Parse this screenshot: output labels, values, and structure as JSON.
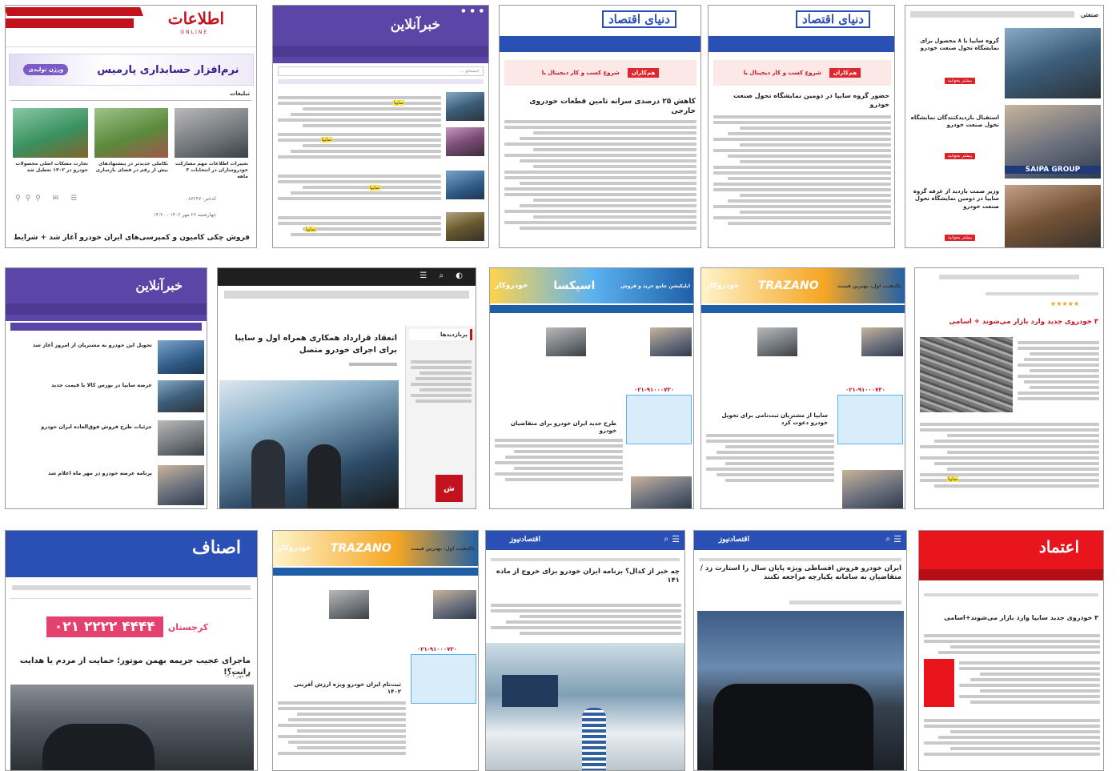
{
  "screens": {
    "s1": {
      "logo": "اطلاعات",
      "logo_sub": "ONLINE",
      "ad_text": "نرم‌افزار حسابداری پارمیس",
      "ad_badge": "ورژن تولیدی",
      "section": "تبلیغات",
      "cards": [
        "تغییرات اطلاعات مهم مشارکت خودروسازان در انتخابات ۳ ماهه",
        "تکاملی جدیدتر در پیشنهادهای بیش از رقم در فضای بازسازی",
        "تجارت مشکات اصلی محصولات خودرو در ۱۴۰۲ تعطیل شد"
      ],
      "meta1": "کدخبر: ۸۶۲۴۷",
      "meta2": "چهارشنبه ۲۶ مهر ۱۴۰۲ - ۱۴:۲۰",
      "headline": "فروش چکی کامیون و کمپرسی‌های ایران خودرو آغاز شد + شرایط"
    },
    "s2": {
      "logo": "خبرآنلاین",
      "search_placeholder": "جستجو ...",
      "highlight": "سایپا"
    },
    "s3": {
      "logo": "دنیای اقتصاد",
      "ad_text": "شروع کسب و کار دیجیتال با",
      "ad_brand": "هم‌کاران",
      "headline": "کاهش ۲۵ درصدی سرانه تامین قطعات خودروی خارجی"
    },
    "s4": {
      "logo": "دنیای اقتصاد",
      "ad_text": "شروع کسب و کار دیجیتال با",
      "ad_brand": "هم‌کاران",
      "headline": "حضور گروه سایپا در دومین نمایشگاه تحول صنعت خودرو"
    },
    "s5": {
      "logo": "صنعتی",
      "items": [
        "گروه سایپا با ۸ محصول برای نمایشگاه تحول صنعت خودرو",
        "استقبال بازدیدکنندگان نمایشگاه تحول صنعت خودرو",
        "وزیر صمت بازدید از غرفه گروه سایپا در دومین نمایشگاه تحول صنعت خودرو"
      ],
      "button": "بیشتر بخوانید",
      "photo_caption": "SAIPA GROUP"
    },
    "s6": {
      "logo": "خبرآنلاین",
      "items": [
        "تحویل این خودرو به مشتریان از امروز آغاز شد",
        "عرضه سایپا در بورس کالا با قیمت جدید",
        "جزئیات طرح فروش فوق‌العاده ایران خودرو",
        "برنامه عرضه خودرو در مهر ماه اعلام شد"
      ]
    },
    "s7": {
      "headline": "انعقاد قرارداد همکاری همراه اول و سایپا برای اجرای خودرو متصل",
      "highlight": "سایپا",
      "tab": "پربازدیدها"
    },
    "s8": {
      "ad_text": "اسپکسا",
      "ad_sub": "اپلیکیشن جامع خرید و فروش",
      "logo": "خودروکار",
      "phone": "۰۲۱-۹۱۰۰۰۷۳۰",
      "headline": "طرح جدید ایران خودرو برای متقاضیان خودرو"
    },
    "s9": {
      "ad_text": "TRAZANO",
      "ad_sub": "باکیفیت اول، بهترین قیمت",
      "logo": "خودروکار",
      "phone": "۰۲۱-۹۱۰۰۰۷۳۰",
      "headline": "سایپا از مشتریان ثبت‌نامی برای تحویل خودرو دعوت کرد"
    },
    "s10": {
      "stars": "★★★★★",
      "headline": "۳ خودروی جدید وارد بازار می‌شوند + اسامی",
      "highlight": "سایپا"
    },
    "s11": {
      "logo": "اصناف",
      "ad_text": "۰۲۱ ۲۲۲۲ ۴۴۴۴",
      "ad_brand": "کرجستان",
      "headline": "ماجرای عجیب جریمه بهمن موتور؛ حمایت از مردم یا هدایت رانت؟!",
      "date": "۲۶ مهر ۱۴۰۲"
    },
    "s12": {
      "ad_text": "TRAZANO",
      "ad_sub": "باکیفیت اول، بهترین قیمت",
      "logo": "خودروکار",
      "phone": "۰۲۱-۹۱۰۰۰۷۳۰",
      "headline": "ثبت‌نام ایران خودرو ویژه ارزش آفرینی ۱۴۰۲"
    },
    "s13": {
      "logo": "اقتصادنیوز",
      "headline": "چه خبر از کدال؟ برنامه ایران خودرو برای خروج از ماده ۱۴۱"
    },
    "s14": {
      "logo": "اقتصادنیوز",
      "headline": "ایران خودرو فروش اقساطی ویژه پایان سال را استارت زد / متقاضیان به سامانه یکپارچه مراجعه نکنند"
    },
    "s15": {
      "logo": "اعتماد",
      "headline": "۳ خودروی جدید سایپا وارد بازار می‌شوند+اسامی"
    }
  },
  "colors": {
    "purple": "#5b45a6",
    "blue": "#2a4fb5",
    "red": "#c2121e",
    "orange": "#f5a623",
    "pink": "#e3426e"
  }
}
